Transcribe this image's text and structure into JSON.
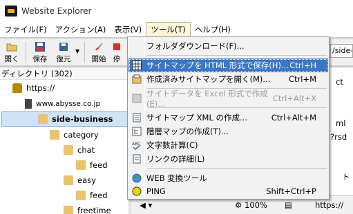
{
  "window": {
    "title": "Website Explorer"
  },
  "menubar": {
    "items": [
      {
        "label": "ファイル(F)"
      },
      {
        "label": "アクション(A)"
      },
      {
        "label": "表示(V)"
      },
      {
        "label": "ツール(T)"
      },
      {
        "label": "ヘルプ(H)"
      }
    ]
  },
  "toolbar": {
    "buttons": [
      {
        "label": "開く",
        "icon": "open-folder-icon"
      },
      {
        "label": "保存",
        "icon": "save-disk-icon"
      },
      {
        "label": "復元",
        "icon": "restore-icon"
      },
      {
        "label": "開始",
        "icon": "start-rocket-icon"
      },
      {
        "label": "停",
        "icon": "stop-icon"
      }
    ],
    "address_partial": "/side-"
  },
  "tree": {
    "header": "ディレクトリ (302)",
    "items": [
      {
        "label": "https://",
        "icon": "lock-icon"
      },
      {
        "label": "www.abysse.co.jp",
        "icon": "page-icon"
      },
      {
        "label": "side-business",
        "icon": "folder-icon",
        "selected": true
      },
      {
        "label": "category",
        "icon": "folder-icon"
      },
      {
        "label": "chat",
        "icon": "folder-icon"
      },
      {
        "label": "feed",
        "icon": "folder-icon"
      },
      {
        "label": "easy",
        "icon": "folder-icon"
      },
      {
        "label": "feed",
        "icon": "folder-icon"
      },
      {
        "label": "freetime",
        "icon": "folder-icon"
      }
    ]
  },
  "right_panel": {
    "fragment_1": "ct",
    "fragment_2": "ml",
    "fragment_3": "?rsd",
    "fragment_4": "ト",
    "zoom": "100%",
    "address_prefix": "https://"
  },
  "tools_menu": {
    "items": [
      {
        "label": "フォルダダウンロード(F)...",
        "shortcut": "",
        "icon": "",
        "disabled": false,
        "highlight": false
      },
      {
        "label": "サイトマップを HTML 形式で保存(H)...",
        "shortcut": "Ctrl+H",
        "icon": "grid-table-icon",
        "disabled": false,
        "highlight": true
      },
      {
        "label": "作成済みサイトマップを開く(M)...",
        "shortcut": "Ctrl+M",
        "icon": "open-sitemap-icon",
        "disabled": false,
        "highlight": false
      },
      {
        "label": "サイトデータを Excel 形式で作成(E)...",
        "shortcut": "Ctrl+Alt+X",
        "icon": "excel-icon",
        "disabled": true,
        "highlight": false
      },
      {
        "label": "サイトマップ XML の作成...",
        "shortcut": "Ctrl+Alt+M",
        "icon": "xml-doc-icon",
        "disabled": false,
        "highlight": false
      },
      {
        "label": "階層マップの作成(T)...",
        "shortcut": "",
        "icon": "hierarchy-map-icon",
        "disabled": false,
        "highlight": false
      },
      {
        "label": "文字数計算(C)",
        "shortcut": "",
        "icon": "char-count-icon",
        "disabled": false,
        "highlight": false
      },
      {
        "label": "リンクの詳細(L)",
        "shortcut": "",
        "icon": "link-detail-icon",
        "disabled": false,
        "highlight": false
      },
      {
        "label": "WEB 変換ツール",
        "shortcut": "",
        "icon": "globe-icon",
        "disabled": false,
        "highlight": false
      },
      {
        "label": "PING",
        "shortcut": "Shift+Ctrl+P",
        "icon": "ping-circle-icon",
        "disabled": false,
        "highlight": false
      }
    ]
  },
  "colors": {
    "menu_highlight": "#3a77c4",
    "selected_row": "#cfe3f7",
    "folder": "#e9c46a"
  }
}
